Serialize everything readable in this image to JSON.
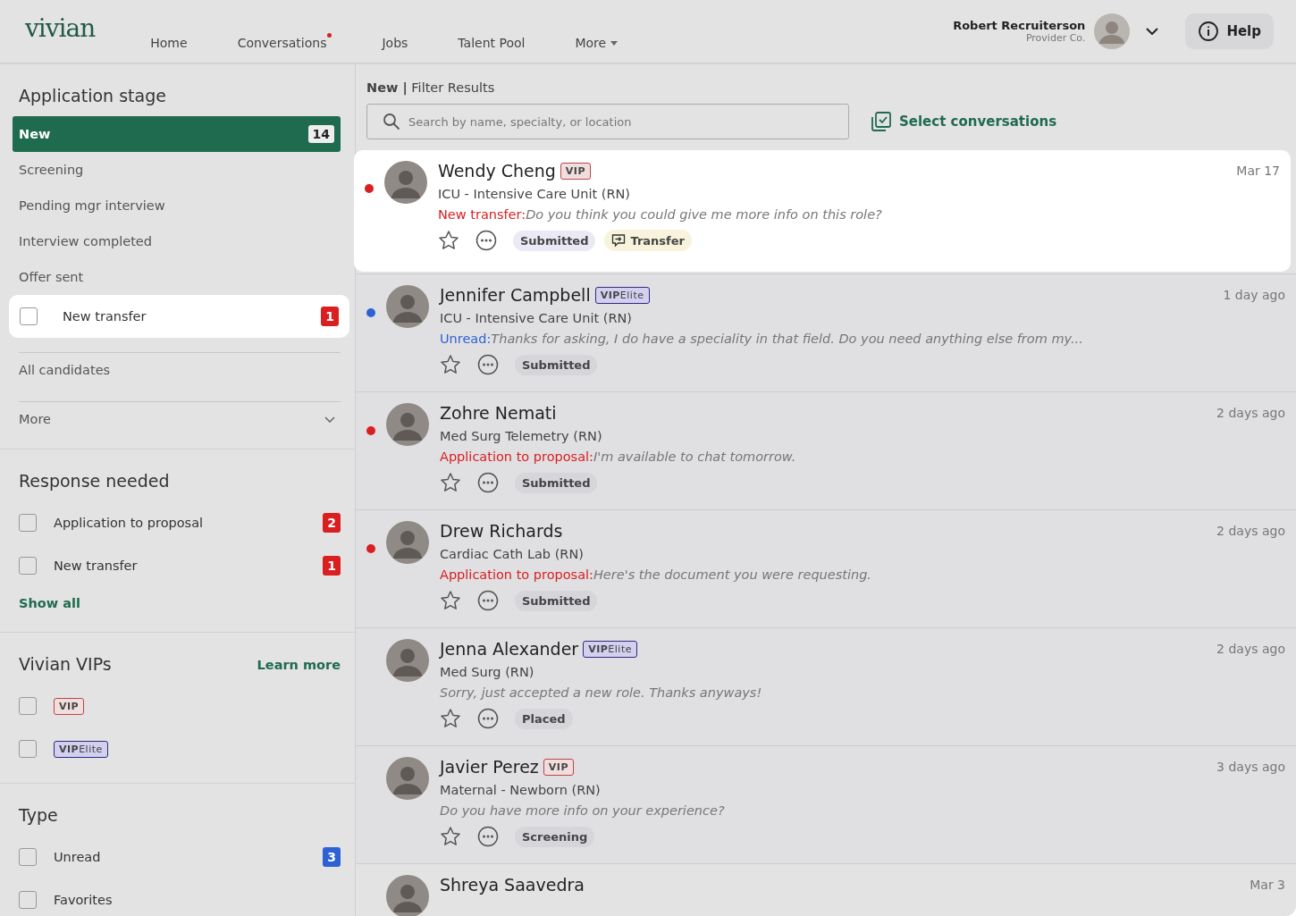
{
  "header": {
    "logo": "vivian",
    "nav": [
      {
        "label": "Home",
        "notify": false,
        "dropdown": false
      },
      {
        "label": "Conversations",
        "notify": true,
        "dropdown": false
      },
      {
        "label": "Jobs",
        "notify": false,
        "dropdown": false
      },
      {
        "label": "Talent Pool",
        "notify": false,
        "dropdown": false
      },
      {
        "label": "More",
        "notify": false,
        "dropdown": true
      }
    ],
    "user": {
      "name": "Robert Recruiterson",
      "company": "Provider Co."
    },
    "help": "Help"
  },
  "sidebar": {
    "stage": {
      "title": "Application stage",
      "items": [
        {
          "label": "New",
          "count": "14",
          "selected": true
        },
        {
          "label": "Screening",
          "selected": false
        },
        {
          "label": "Pending mgr interview",
          "selected": false
        },
        {
          "label": "Interview completed",
          "selected": false
        },
        {
          "label": "Offer sent",
          "selected": false
        }
      ],
      "spotlight": {
        "label": "New transfer",
        "count": "1",
        "checked": false
      },
      "all": "All candidates",
      "more": "More"
    },
    "response": {
      "title": "Response needed",
      "items": [
        {
          "label": "Application to proposal",
          "count": "2",
          "checked": false,
          "color": "#d91f1f"
        },
        {
          "label": "New transfer",
          "count": "1",
          "checked": false,
          "color": "#d91f1f"
        }
      ],
      "show_all": "Show all"
    },
    "vips": {
      "title": "Vivian VIPs",
      "link": "Learn more",
      "items": [
        {
          "tag": "VIP",
          "kind": "vip",
          "checked": false
        },
        {
          "tag": "**VIP**Elite",
          "kind": "elite",
          "checked": false
        }
      ]
    },
    "type": {
      "title": "Type",
      "items": [
        {
          "label": "Unread",
          "count": "3",
          "checked": false,
          "color": "#2e62d4"
        },
        {
          "label": "Favorites",
          "checked": false
        }
      ]
    }
  },
  "main": {
    "breadcrumb": "**New |** Filter Results",
    "search": {
      "placeholder": "Search by name, specialty, or location"
    },
    "select": "Select conversations",
    "conversations": [
      {
        "name": "Wendy Cheng",
        "tag": {
          "text": "VIP",
          "kind": "vip"
        },
        "role": "ICU - Intensive Care Unit (RN)",
        "prefix": {
          "text": "New transfer:",
          "kind": "alert"
        },
        "message": "Do you think you could give me more info on this role?",
        "status": "Submitted",
        "transfer": "Transfer",
        "date": "Mar 17",
        "color": "#d91f1f",
        "highlighted": true
      },
      {
        "name": "Jennifer Campbell",
        "tag": {
          "text": "**VIP**Elite",
          "kind": "elite"
        },
        "role": "ICU - Intensive Care Unit (RN)",
        "prefix": {
          "text": "Unread:",
          "kind": "unread"
        },
        "message": "Thanks for asking, I do have a speciality in that field. Do you need anything else from my...",
        "status": "Submitted",
        "date": "1 day ago",
        "color": "#2e62d4",
        "highlighted": false
      },
      {
        "name": "Zohre Nemati",
        "role": "Med Surg Telemetry (RN)",
        "prefix": {
          "text": "Application to proposal:",
          "kind": "alert"
        },
        "message": "I'm available to chat tomorrow.",
        "status": "Submitted",
        "date": "2 days ago",
        "color": "#d91f1f",
        "highlighted": false
      },
      {
        "name": "Drew Richards",
        "role": "Cardiac Cath Lab (RN)",
        "prefix": {
          "text": "Application to proposal:",
          "kind": "alert"
        },
        "message": "Here's the document you were requesting.",
        "status": "Submitted",
        "date": "2 days ago",
        "color": "#d91f1f",
        "highlighted": false
      },
      {
        "name": "Jenna Alexander",
        "tag": {
          "text": "**VIP**Elite",
          "kind": "elite"
        },
        "role": "Med Surg (RN)",
        "message": "Sorry, just accepted a new role. Thanks anyways!",
        "status": "Placed",
        "date": "2 days ago",
        "highlighted": false
      },
      {
        "name": "Javier Perez",
        "tag": {
          "text": "VIP",
          "kind": "vip"
        },
        "role": "Maternal - Newborn (RN)",
        "message": "Do you have more info on your experience?",
        "status": "Screening",
        "date": "3 days ago",
        "highlighted": false
      },
      {
        "name": "Shreya Saavedra",
        "date": "Mar 3",
        "highlighted": false
      }
    ]
  }
}
